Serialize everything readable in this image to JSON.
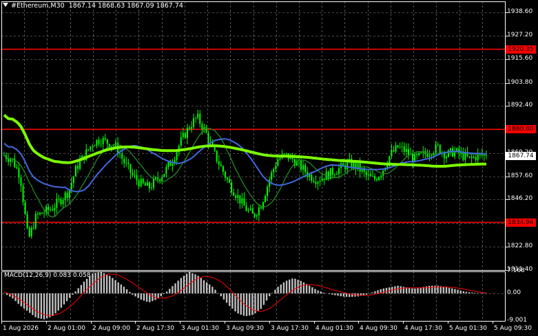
{
  "header": {
    "symbol_label": "#Ethereum,M30",
    "ohlc": "1867.14 1868.63 1867.09 1867.74"
  },
  "price_axis": {
    "labels": [
      "1938.60",
      "1927.20",
      "1915.60",
      "1903.80",
      "1892.40",
      "1880.80",
      "1869.20",
      "1857.60",
      "1846.20",
      "1834.60",
      "1822.80",
      "1811.40"
    ]
  },
  "horizontal_lines": [
    {
      "label": "1920.35",
      "value": 1920.35,
      "color": "#ff0000"
    },
    {
      "label": "1880.80",
      "value": 1880.8,
      "color": "#ff0000"
    },
    {
      "label": "1834.94",
      "value": 1834.94,
      "color": "#ff0000"
    }
  ],
  "current_price": {
    "label": "1867.74",
    "value": 1867.74
  },
  "macd": {
    "title": "MACD(12,26,9) 0.083 0.058",
    "axis_labels": [
      "7.168",
      "0.00",
      "-9.001"
    ]
  },
  "time_axis": {
    "labels": [
      "1 Aug 2026",
      "2 Aug 01:00",
      "2 Aug 09:00",
      "2 Aug 17:30",
      "3 Aug 01:30",
      "3 Aug 09:30",
      "3 Aug 17:30",
      "4 Aug 01:30",
      "4 Aug 09:30",
      "4 Aug 17:30",
      "5 Aug 01:30",
      "5 Aug 09:30"
    ]
  },
  "colors": {
    "background": "#000000",
    "candles": "#00ff00",
    "ma_fast": "#228b22",
    "ma_slow": "#4169e1",
    "ma_long": "#7cfc00",
    "macd_hist": "#c0c0c0",
    "macd_signal": "#ff0000",
    "grid": "#c0c0c0",
    "levels": "#ff0000"
  },
  "chart_data": {
    "type": "candlestick",
    "timeframe": "M30",
    "ylim": [
      1811.4,
      1944.0
    ],
    "close_path": [
      1868,
      1866,
      1858,
      1826,
      1838,
      1840,
      1842,
      1846,
      1850,
      1862,
      1868,
      1874,
      1876,
      1874,
      1872,
      1864,
      1858,
      1854,
      1852,
      1856,
      1860,
      1866,
      1875,
      1882,
      1887,
      1880,
      1870,
      1862,
      1854,
      1848,
      1842,
      1838,
      1844,
      1856,
      1866,
      1868,
      1866,
      1862,
      1858,
      1856,
      1858,
      1860,
      1862,
      1864,
      1862,
      1858,
      1856,
      1860,
      1868,
      1872,
      1870,
      1866,
      1868,
      1870,
      1872,
      1868,
      1870,
      1868,
      1866,
      1868,
      1867.74
    ],
    "macd_hist": [
      0,
      -1.5,
      -4,
      -6,
      -8,
      -8.5,
      -7.5,
      -5,
      -2,
      1,
      4,
      6.5,
      7,
      6,
      4,
      2,
      -0.5,
      -2,
      -3,
      -2,
      0,
      2.5,
      5,
      7,
      6,
      4,
      2,
      -1,
      -4,
      -6.5,
      -7.5,
      -7,
      -5,
      -1,
      2,
      4,
      5,
      4,
      2.5,
      1,
      0,
      -0.5,
      -1,
      -1.2,
      -1,
      -0.5,
      0.5,
      1.5,
      2,
      2.5,
      2,
      1.5,
      2,
      2.5,
      2.5,
      2,
      1.5,
      0.8,
      0.3,
      0.1,
      0.083
    ],
    "macd_signal": [
      0.5,
      -0.5,
      -2,
      -4,
      -5.8,
      -7,
      -7.3,
      -6.5,
      -4.8,
      -2.4,
      0.5,
      3,
      5.2,
      6.3,
      6.2,
      5,
      3.4,
      1.5,
      -0.3,
      -1.5,
      -1.6,
      -0.8,
      0.9,
      3,
      4.8,
      5.6,
      5.2,
      3.8,
      1.5,
      -1.3,
      -3.8,
      -5.5,
      -6,
      -5,
      -3,
      -0.8,
      1.2,
      2.5,
      2.9,
      2.6,
      1.9,
      1.1,
      0.4,
      -0.2,
      -0.6,
      -0.7,
      -0.4,
      0.2,
      0.9,
      1.5,
      1.8,
      1.8,
      1.8,
      1.9,
      2.1,
      2.1,
      1.9,
      1.5,
      1,
      0.5,
      0.058
    ],
    "macd_ylim": [
      -9.001,
      7.168
    ]
  }
}
